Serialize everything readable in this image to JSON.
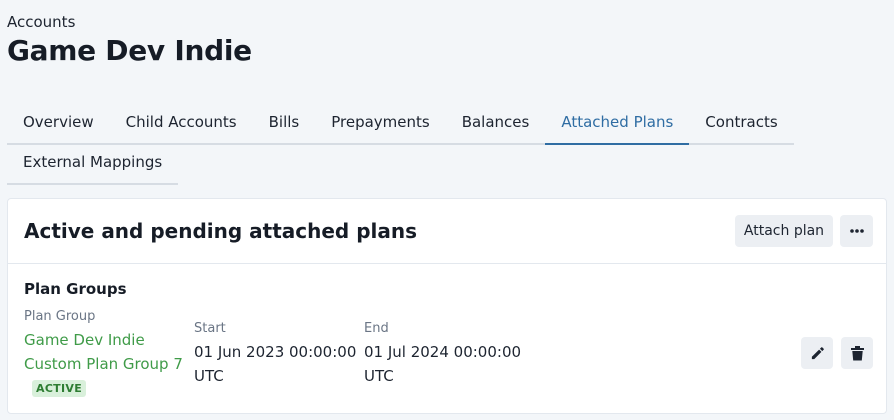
{
  "breadcrumb": "Accounts",
  "page_title": "Game Dev Indie",
  "tabs": [
    {
      "label": "Overview",
      "active": false
    },
    {
      "label": "Child Accounts",
      "active": false
    },
    {
      "label": "Bills",
      "active": false
    },
    {
      "label": "Prepayments",
      "active": false
    },
    {
      "label": "Balances",
      "active": false
    },
    {
      "label": "Attached Plans",
      "active": true
    },
    {
      "label": "Contracts",
      "active": false
    },
    {
      "label": "External Mappings",
      "active": false
    }
  ],
  "card": {
    "title": "Active and pending attached plans",
    "attach_button": "Attach plan",
    "more_icon": "more-horizontal-icon",
    "section_title": "Plan Groups",
    "columns": {
      "plan_group": "Plan Group",
      "start": "Start",
      "end": "End"
    },
    "row": {
      "plan_group_line1": "Game Dev Indie",
      "plan_group_line2": "Custom Plan Group 7",
      "status": "ACTIVE",
      "start_date": "01 Jun 2023 00:00:00",
      "start_tz": "UTC",
      "end_date": "01 Jul 2024 00:00:00",
      "end_tz": "UTC",
      "edit_icon": "pencil-icon",
      "delete_icon": "trash-icon"
    }
  },
  "colors": {
    "accent": "#2f6da3",
    "link_green": "#3f9b48",
    "badge_bg": "#d9f0db",
    "badge_text": "#2e7d32",
    "page_bg": "#f3f6f9"
  }
}
